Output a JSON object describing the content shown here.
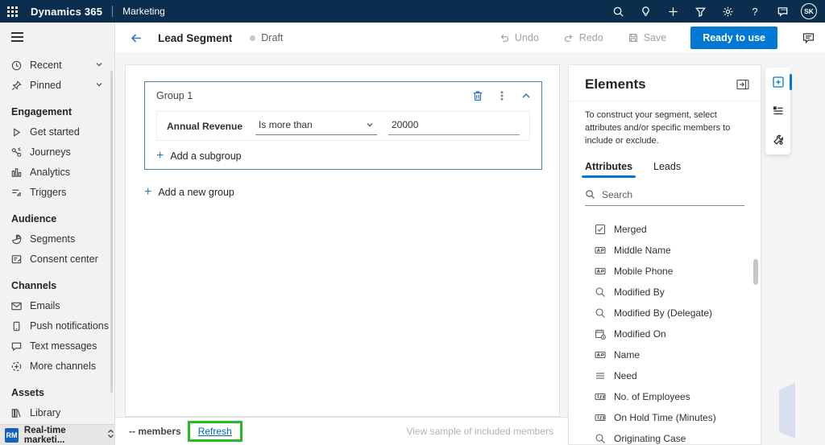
{
  "colors": {
    "topbar_bg": "#0c2e4e",
    "primary_blue": "#0078d4",
    "group_border": "#4a80bd",
    "annotation_green": "#28b928"
  },
  "topbar": {
    "product": "Dynamics 365",
    "app": "Marketing",
    "avatar_initials": "SK",
    "icons": [
      "search-icon",
      "lightbulb-icon",
      "add-icon",
      "filter-icon",
      "settings-icon",
      "help-icon",
      "feedback-icon"
    ]
  },
  "cmdbar": {
    "title": "Lead Segment",
    "status": "Draft",
    "undo": "Undo",
    "redo": "Redo",
    "save": "Save",
    "primary": "Ready to use"
  },
  "sidebar": {
    "recent": "Recent",
    "pinned": "Pinned",
    "engagement_header": "Engagement",
    "get_started": "Get started",
    "journeys": "Journeys",
    "analytics": "Analytics",
    "triggers": "Triggers",
    "audience_header": "Audience",
    "segments": "Segments",
    "consent_center": "Consent center",
    "channels_header": "Channels",
    "emails": "Emails",
    "push_notifications": "Push notifications",
    "text_messages": "Text messages",
    "more_channels": "More channels",
    "assets_header": "Assets",
    "library": "Library",
    "area_badge": "RM",
    "area_label": "Real-time marketi..."
  },
  "canvas": {
    "group_title": "Group 1",
    "condition": {
      "attribute": "Annual Revenue",
      "operator": "Is more than",
      "value": "20000"
    },
    "add_subgroup": "Add a subgroup",
    "add_group": "Add a new group"
  },
  "footer": {
    "members": "-- members",
    "refresh": "Refresh",
    "view_sample": "View sample of included members"
  },
  "elements": {
    "title": "Elements",
    "description": "To construct your segment, select attributes and/or specific members to include or exclude.",
    "tab_attributes": "Attributes",
    "tab_leads": "Leads",
    "search_placeholder": "Search",
    "attributes": [
      {
        "label": "Merged",
        "type": "boolean"
      },
      {
        "label": "Middle Name",
        "type": "text"
      },
      {
        "label": "Mobile Phone",
        "type": "text"
      },
      {
        "label": "Modified By",
        "type": "lookup"
      },
      {
        "label": "Modified By (Delegate)",
        "type": "lookup"
      },
      {
        "label": "Modified On",
        "type": "datetime"
      },
      {
        "label": "Name",
        "type": "text"
      },
      {
        "label": "Need",
        "type": "optionset"
      },
      {
        "label": "No. of Employees",
        "type": "number"
      },
      {
        "label": "On Hold Time (Minutes)",
        "type": "number"
      },
      {
        "label": "Originating Case",
        "type": "lookup"
      }
    ]
  }
}
